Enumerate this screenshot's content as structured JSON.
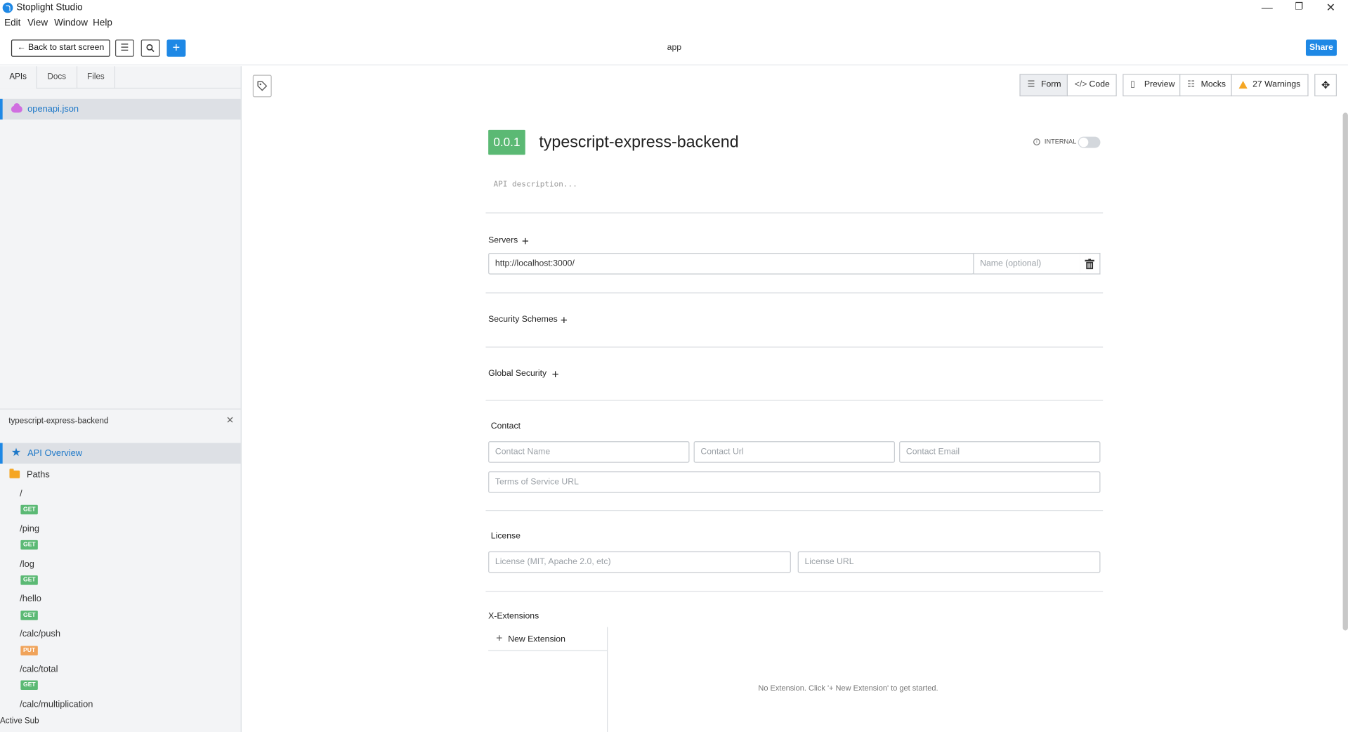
{
  "window": {
    "title": "Stoplight Studio",
    "minimize": "—",
    "restore": "❐",
    "close": "✕"
  },
  "menu": [
    "Edit",
    "View",
    "Window",
    "Help"
  ],
  "toolbar": {
    "back_label": "Back to start screen",
    "app_name": "app",
    "share_label": "Share"
  },
  "sidebar": {
    "tabs": [
      "APIs",
      "Docs",
      "Files"
    ],
    "active_tab": "APIs",
    "file_name": "openapi.json",
    "outline_title": "typescript-express-backend",
    "overview_label": "API Overview",
    "paths_label": "Paths",
    "paths": [
      {
        "path": "/",
        "method": "GET"
      },
      {
        "path": "/ping",
        "method": "GET"
      },
      {
        "path": "/log",
        "method": "GET"
      },
      {
        "path": "/hello",
        "method": "GET"
      },
      {
        "path": "/calc/push",
        "method": "PUT"
      },
      {
        "path": "/calc/total",
        "method": "GET"
      },
      {
        "path": "/calc/multiplication",
        "method": ""
      }
    ],
    "footer": "Active Sub"
  },
  "main": {
    "view_buttons": {
      "form": "Form",
      "code": "Code",
      "preview": "Preview",
      "mocks": "Mocks",
      "warnings": "27 Warnings"
    },
    "version": "0.0.1",
    "api_title": "typescript-express-backend",
    "internal_label": "INTERNAL",
    "description_placeholder": "API description...",
    "servers_label": "Servers",
    "server_url": "http://localhost:3000/",
    "server_name_placeholder": "Name (optional)",
    "security_schemes_label": "Security Schemes",
    "global_security_label": "Global Security",
    "contact_label": "Contact",
    "contact_name_placeholder": "Contact Name",
    "contact_url_placeholder": "Contact Url",
    "contact_email_placeholder": "Contact Email",
    "tos_placeholder": "Terms of Service URL",
    "license_label": "License",
    "license_name_placeholder": "License (MIT, Apache 2.0, etc)",
    "license_url_placeholder": "License URL",
    "xext_label": "X-Extensions",
    "new_extension_label": "New Extension",
    "no_extension_text": "No Extension. Click '+ New Extension' to get started."
  },
  "colors": {
    "accent": "#1e88e5",
    "get": "#5bb974",
    "put": "#f0a35a",
    "warning": "#f5a623",
    "file_icon": "#d06ee0"
  }
}
